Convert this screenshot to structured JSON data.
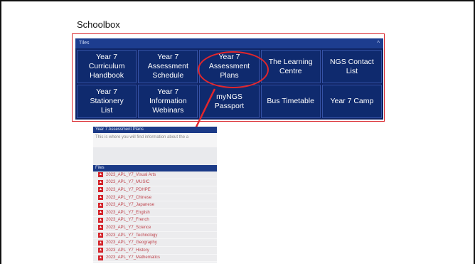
{
  "document": {
    "title": "Schoolbox"
  },
  "tiles": {
    "header_label": "Tiles",
    "collapse_glyph": "^",
    "items": [
      {
        "label": "Year 7 Curriculum\nHandbook"
      },
      {
        "label": "Year 7\nAssessment\nSchedule"
      },
      {
        "label": "Year 7\nAssessment Plans"
      },
      {
        "label": "The Learning\nCentre"
      },
      {
        "label": "NGS Contact List"
      },
      {
        "label": "Year 7 Stationery\nList"
      },
      {
        "label": "Year 7\nInformation\nWebinars"
      },
      {
        "label": "myNGS Passport"
      },
      {
        "label": "Bus Timetable"
      },
      {
        "label": "Year 7 Camp"
      }
    ]
  },
  "assessment_page": {
    "title": "Year 7 Assessment Plans",
    "description": "This is where you will find information about the a",
    "files_label": "Files",
    "files": [
      {
        "name": "2023_APL_Y7_Visual Arts"
      },
      {
        "name": "2023_APL_Y7_MUSIC"
      },
      {
        "name": "2023_APL_Y7_PDHPE"
      },
      {
        "name": "2023_APL_Y7_Chinese"
      },
      {
        "name": "2023_APL_Y7_Japanese"
      },
      {
        "name": "2023_APL_Y7_English"
      },
      {
        "name": "2023_APL_Y7_French"
      },
      {
        "name": "2023_APL_Y7_Science"
      },
      {
        "name": "2023_APL_Y7_Technology"
      },
      {
        "name": "2023_APL_Y7_Geography"
      },
      {
        "name": "2023_APL_Y7_History"
      },
      {
        "name": "2023_APL_Y7_Mathematics"
      }
    ]
  },
  "icons": {
    "file": "pdf-file-icon",
    "collapse": "chevron-up-icon"
  },
  "colors": {
    "annotation": "#e0262c",
    "tile_background": "#0f2a6e",
    "file_link": "#c0464f"
  }
}
